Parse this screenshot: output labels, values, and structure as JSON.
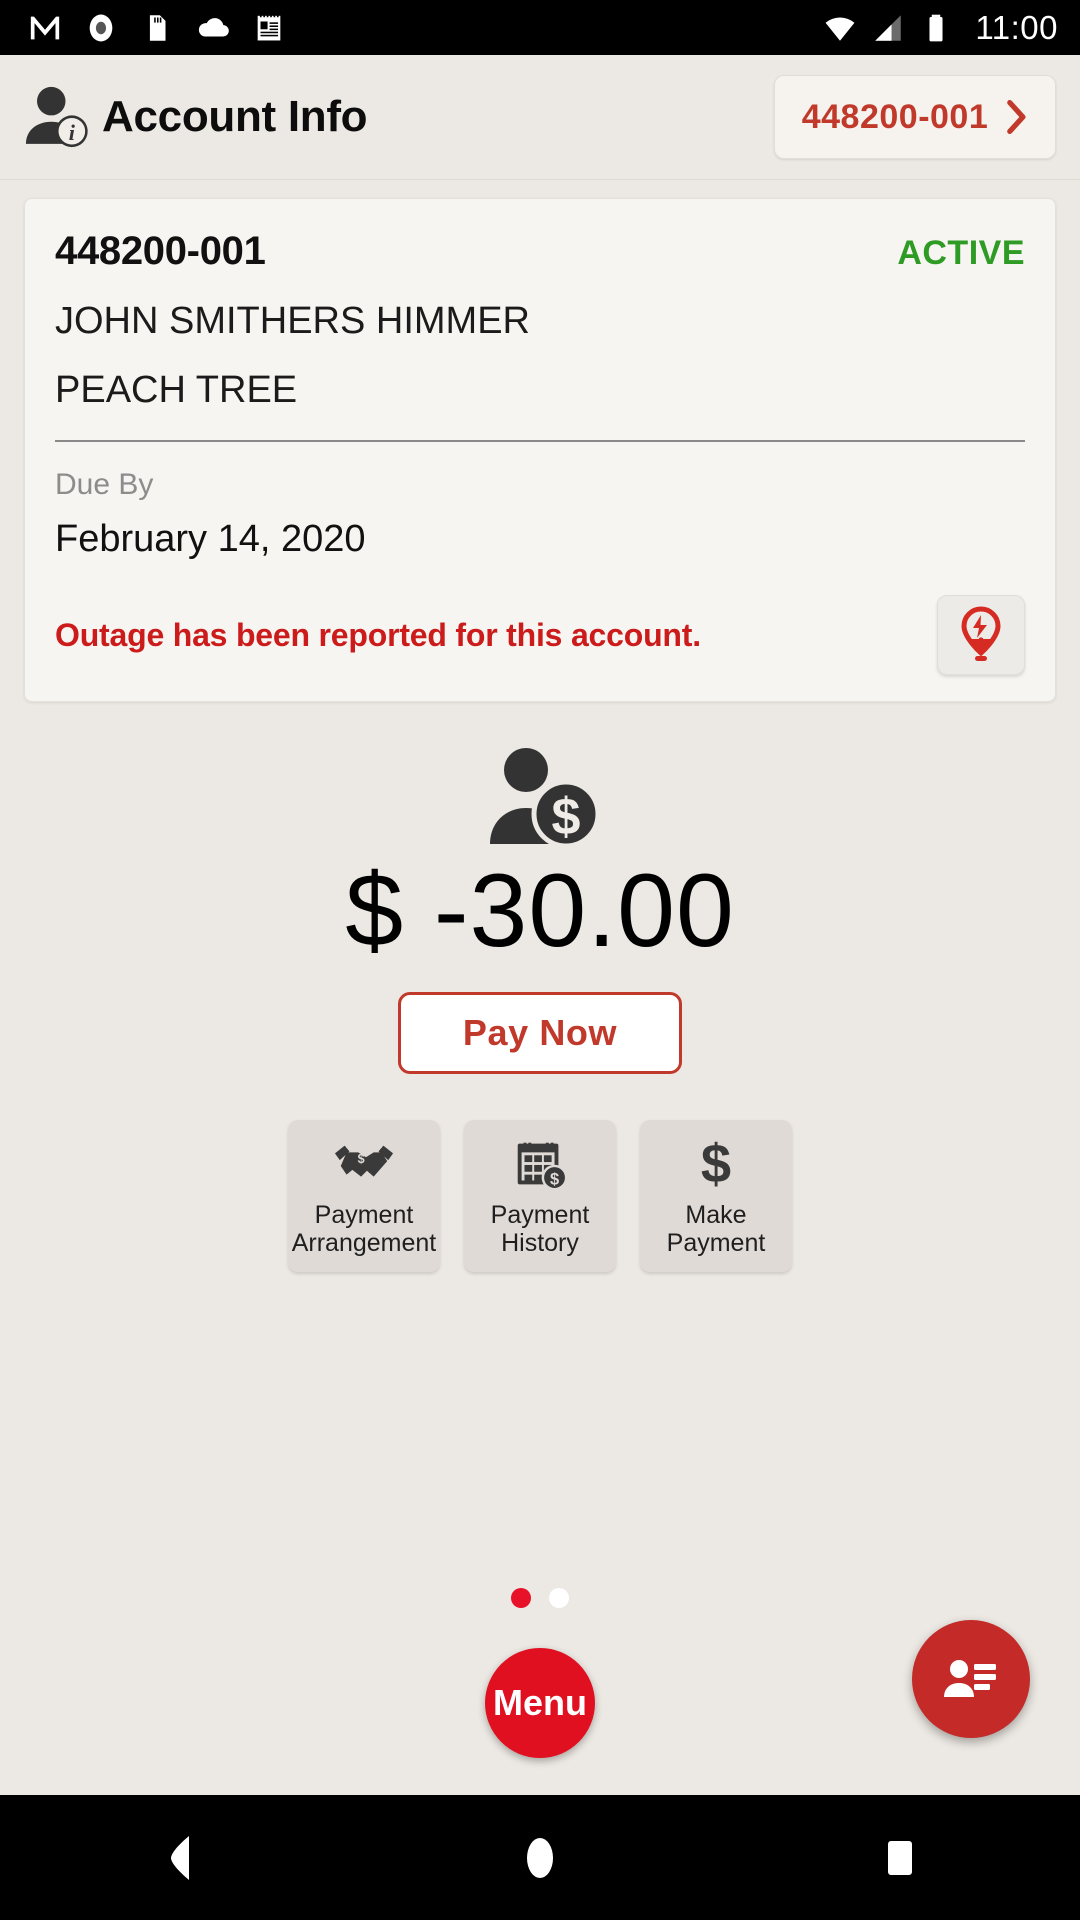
{
  "status_bar": {
    "time": "11:00",
    "left_icons": [
      "gmail-icon",
      "record-circle-icon",
      "sd-card-icon",
      "cloud-icon",
      "notepad-icon"
    ],
    "right_icons": [
      "wifi-icon",
      "cell-signal-icon",
      "battery-icon"
    ]
  },
  "header": {
    "title": "Account Info",
    "icon": "account-info-person-icon",
    "account_pill": {
      "number": "448200-001",
      "chevron": "chevron-right-icon"
    }
  },
  "account_card": {
    "account_number": "448200-001",
    "status": "ACTIVE",
    "status_color": "#2e9b24",
    "customer_name": "JOHN SMITHERS HIMMER",
    "service_address": "PEACH TREE",
    "due_by_label": "Due By",
    "due_by_date": "February 14, 2020",
    "outage_message": "Outage has been reported for this account.",
    "outage_color": "#cc1b1b",
    "outage_icon": "outage-pin-bolt-icon"
  },
  "balance": {
    "icon": "person-dollar-icon",
    "amount": "$ -30.00",
    "pay_now_label": "Pay Now",
    "accent_color": "#c0392b"
  },
  "tiles": [
    {
      "label_line1": "Payment",
      "label_line2": "Arrangement",
      "icon": "handshake-dollar-icon"
    },
    {
      "label_line1": "Payment",
      "label_line2": "History",
      "icon": "calendar-dollar-icon"
    },
    {
      "label_line1": "Make",
      "label_line2": "Payment",
      "icon": "dollar-sign-icon"
    }
  ],
  "pager": {
    "total": 2,
    "active_index": 0,
    "active_color": "#e8112a",
    "inactive_color": "#ffffff"
  },
  "menu_fab": {
    "label": "Menu",
    "color": "#e01020"
  },
  "contact_fab": {
    "icon": "contact-list-icon",
    "color": "#c32a28"
  },
  "nav_bar": {
    "back": "back-triangle-icon",
    "home": "home-circle-icon",
    "recents": "recents-square-icon"
  }
}
